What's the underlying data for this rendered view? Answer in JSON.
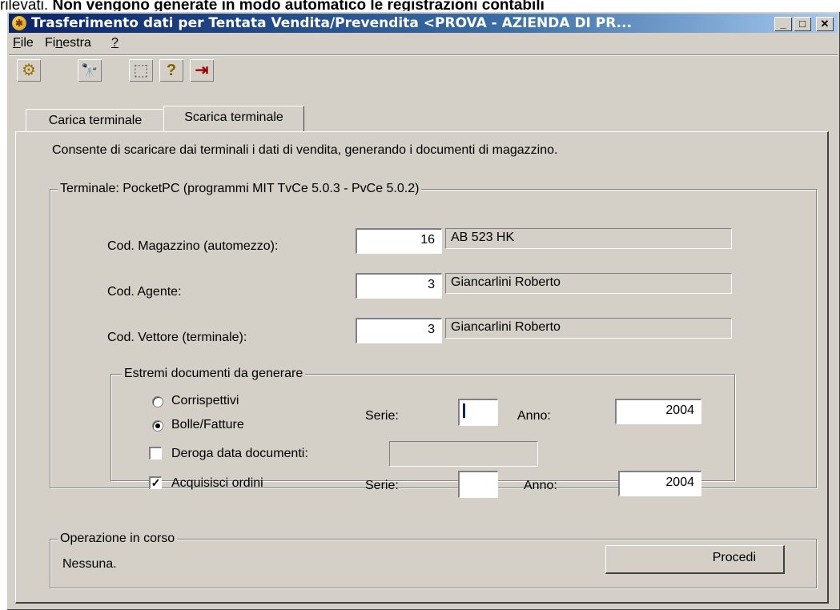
{
  "document_line": {
    "normal_text": "rilevati. ",
    "bold_text": "Non vengono generate in modo automatico le registrazioni contabili"
  },
  "window": {
    "title": "Trasferimento dati per Tentata Vendita/Prevendita <PROVA - AZIENDA DI PR...",
    "controls": [
      "minimize",
      "maximize",
      "close"
    ]
  },
  "menu": {
    "items": [
      {
        "label": "File"
      },
      {
        "label": "Finestra"
      },
      {
        "label": "?"
      }
    ]
  },
  "toolbar": {
    "buttons": [
      {
        "icon": "settings-gear-icon",
        "glyph": "⚙"
      },
      {
        "icon": "binoculars-icon",
        "glyph": "🔭"
      },
      {
        "icon": "select-area-icon",
        "glyph": "⬚"
      },
      {
        "icon": "help-icon",
        "glyph": "?"
      },
      {
        "icon": "exit-door-icon",
        "glyph": "⇥"
      }
    ]
  },
  "tabs": [
    {
      "label": "Carica terminale",
      "active": false
    },
    {
      "label": "Scarica terminale",
      "active": true
    }
  ],
  "panel": {
    "description": "Consente di scaricare dai terminali i dati di vendita, generando i documenti di magazzino.",
    "terminal_group": {
      "title": "Terminale: PocketPC (programmi MIT TvCe 5.0.3 - PvCe 5.0.2)",
      "fields": [
        {
          "label": "Cod. Magazzino (automezzo):",
          "code": "16",
          "description": "AB 523 HK"
        },
        {
          "label": "Cod. Agente:",
          "code": "3",
          "description": "Giancarlini Roberto"
        },
        {
          "label": "Cod. Vettore (terminale):",
          "code": "3",
          "description": "Giancarlini Roberto"
        }
      ]
    },
    "documents_group": {
      "title": "Estremi documenti da generare",
      "radio_corrispettivi": {
        "label": "Corrispettivi",
        "checked": false
      },
      "radio_bolle": {
        "label": "Bolle/Fatture",
        "checked": true
      },
      "serie1_label": "Serie:",
      "serie1_value": "",
      "anno1_label": "Anno:",
      "anno1_value": "2004",
      "deroga": {
        "label": "Deroga data documenti:",
        "checked": false,
        "value": ""
      },
      "acquisisci": {
        "label": "Acquisisci ordini",
        "checked": true
      },
      "serie2_label": "Serie:",
      "serie2_value": "",
      "anno2_label": "Anno:",
      "anno2_value": "2004"
    },
    "operation_group": {
      "title": "Operazione in corso",
      "status": "Nessuna.",
      "button_label": "Procedi"
    }
  }
}
